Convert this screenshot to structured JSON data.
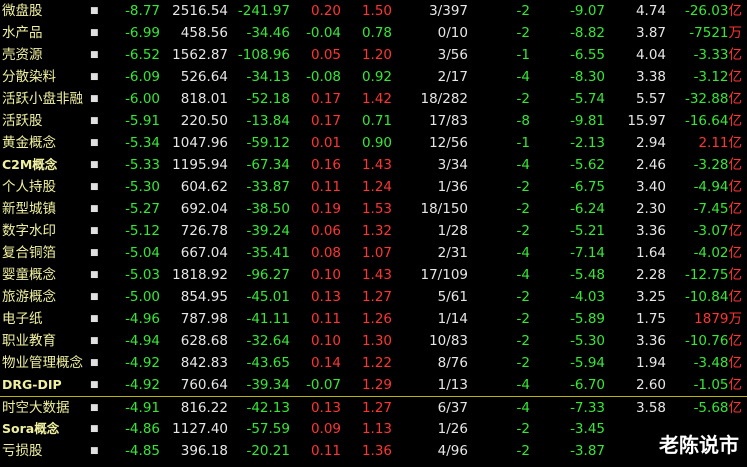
{
  "colors": {
    "background": "#000000",
    "down": "#35e835",
    "up": "#ff3434",
    "neutral": "#e6e6e6",
    "name": "#f0f0a0",
    "divider": "#b8b400"
  },
  "rows": [
    {
      "name": "微盘股",
      "flag": "■",
      "pct": "-8.77",
      "price": "2516.54",
      "chg": "-241.97",
      "spd": "0.20",
      "vol": "1.50",
      "rf": "3/397",
      "tc": "-2",
      "d5": "-9.07",
      "tor": "4.74",
      "flow": "-26.03",
      "unit": "亿"
    },
    {
      "name": "水产品",
      "flag": "■",
      "pct": "-6.99",
      "price": "458.56",
      "chg": "-34.46",
      "spd": "-0.04",
      "vol": "0.78",
      "rf": "0/10",
      "tc": "-2",
      "d5": "-8.82",
      "tor": "3.87",
      "flow": "-7521",
      "unit": "万"
    },
    {
      "name": "壳资源",
      "flag": "■",
      "pct": "-6.52",
      "price": "1562.87",
      "chg": "-108.96",
      "spd": "0.05",
      "vol": "1.20",
      "rf": "3/56",
      "tc": "-1",
      "d5": "-6.55",
      "tor": "4.04",
      "flow": "-3.33",
      "unit": "亿"
    },
    {
      "name": "分散染料",
      "flag": "■",
      "pct": "-6.09",
      "price": "526.64",
      "chg": "-34.13",
      "spd": "-0.08",
      "vol": "0.92",
      "rf": "2/17",
      "tc": "-4",
      "d5": "-8.30",
      "tor": "3.38",
      "flow": "-3.12",
      "unit": "亿"
    },
    {
      "name": "活跃小盘非融",
      "flag": "■",
      "pct": "-6.00",
      "price": "818.01",
      "chg": "-52.18",
      "spd": "0.17",
      "vol": "1.42",
      "rf": "18/282",
      "tc": "-2",
      "d5": "-5.74",
      "tor": "5.57",
      "flow": "-32.88",
      "unit": "亿"
    },
    {
      "name": "活跃股",
      "flag": "■",
      "pct": "-5.91",
      "price": "220.50",
      "chg": "-13.84",
      "spd": "0.17",
      "vol": "0.71",
      "rf": "17/83",
      "tc": "-8",
      "d5": "-9.81",
      "tor": "15.97",
      "flow": "-16.64",
      "unit": "亿"
    },
    {
      "name": "黄金概念",
      "flag": "■",
      "pct": "-5.34",
      "price": "1047.96",
      "chg": "-59.12",
      "spd": "0.01",
      "vol": "0.90",
      "rf": "12/56",
      "tc": "-1",
      "d5": "-2.13",
      "tor": "2.94",
      "flow": "2.11",
      "unit": "亿"
    },
    {
      "name": "C2M概念",
      "flag": "■",
      "pct": "-5.33",
      "price": "1195.94",
      "chg": "-67.34",
      "spd": "0.16",
      "vol": "1.43",
      "rf": "3/34",
      "tc": "-4",
      "d5": "-5.62",
      "tor": "2.46",
      "flow": "-3.28",
      "unit": "亿"
    },
    {
      "name": "个人持股",
      "flag": "■",
      "pct": "-5.30",
      "price": "604.62",
      "chg": "-33.87",
      "spd": "0.11",
      "vol": "1.24",
      "rf": "1/36",
      "tc": "-2",
      "d5": "-6.75",
      "tor": "3.40",
      "flow": "-4.94",
      "unit": "亿"
    },
    {
      "name": "新型城镇",
      "flag": "■",
      "pct": "-5.27",
      "price": "692.04",
      "chg": "-38.50",
      "spd": "0.19",
      "vol": "1.53",
      "rf": "18/150",
      "tc": "-2",
      "d5": "-6.24",
      "tor": "2.30",
      "flow": "-7.45",
      "unit": "亿"
    },
    {
      "name": "数字水印",
      "flag": "■",
      "pct": "-5.12",
      "price": "726.78",
      "chg": "-39.24",
      "spd": "0.06",
      "vol": "1.32",
      "rf": "1/28",
      "tc": "-2",
      "d5": "-5.21",
      "tor": "3.36",
      "flow": "-3.07",
      "unit": "亿"
    },
    {
      "name": "复合铜箔",
      "flag": "■",
      "pct": "-5.04",
      "price": "667.04",
      "chg": "-35.41",
      "spd": "0.08",
      "vol": "1.07",
      "rf": "2/31",
      "tc": "-4",
      "d5": "-7.14",
      "tor": "1.64",
      "flow": "-4.02",
      "unit": "亿"
    },
    {
      "name": "婴童概念",
      "flag": "■",
      "pct": "-5.03",
      "price": "1818.92",
      "chg": "-96.27",
      "spd": "0.10",
      "vol": "1.43",
      "rf": "17/109",
      "tc": "-4",
      "d5": "-5.48",
      "tor": "2.28",
      "flow": "-12.75",
      "unit": "亿"
    },
    {
      "name": "旅游概念",
      "flag": "■",
      "pct": "-5.00",
      "price": "854.95",
      "chg": "-45.01",
      "spd": "0.13",
      "vol": "1.27",
      "rf": "5/61",
      "tc": "-2",
      "d5": "-4.03",
      "tor": "3.25",
      "flow": "-10.84",
      "unit": "亿"
    },
    {
      "name": "电子纸",
      "flag": "■",
      "pct": "-4.96",
      "price": "787.98",
      "chg": "-41.11",
      "spd": "0.11",
      "vol": "1.26",
      "rf": "1/14",
      "tc": "-2",
      "d5": "-5.89",
      "tor": "1.75",
      "flow": "1879",
      "unit": "万"
    },
    {
      "name": "职业教育",
      "flag": "■",
      "pct": "-4.94",
      "price": "628.68",
      "chg": "-32.64",
      "spd": "0.10",
      "vol": "1.30",
      "rf": "10/83",
      "tc": "-2",
      "d5": "-5.30",
      "tor": "3.36",
      "flow": "-10.76",
      "unit": "亿"
    },
    {
      "name": "物业管理概念",
      "flag": "■",
      "pct": "-4.92",
      "price": "842.83",
      "chg": "-43.65",
      "spd": "0.14",
      "vol": "1.22",
      "rf": "8/76",
      "tc": "-2",
      "d5": "-5.94",
      "tor": "1.94",
      "flow": "-3.48",
      "unit": "亿"
    },
    {
      "name": "DRG-DIP",
      "flag": "■",
      "pct": "-4.92",
      "price": "760.64",
      "chg": "-39.34",
      "spd": "-0.07",
      "vol": "1.29",
      "rf": "1/13",
      "tc": "-4",
      "d5": "-6.70",
      "tor": "2.60",
      "flow": "-1.05",
      "unit": "亿"
    },
    {
      "name": "时空大数据",
      "flag": "■",
      "pct": "-4.91",
      "price": "816.22",
      "chg": "-42.13",
      "spd": "0.13",
      "vol": "1.27",
      "rf": "6/37",
      "tc": "-4",
      "d5": "-7.33",
      "tor": "3.58",
      "flow": "-5.68",
      "unit": "亿"
    },
    {
      "name": "Sora概念",
      "flag": "■",
      "pct": "-4.86",
      "price": "1127.40",
      "chg": "-57.59",
      "spd": "0.09",
      "vol": "1.13",
      "rf": "1/26",
      "tc": "-2",
      "d5": "-3.45",
      "tor": "",
      "flow": "",
      "unit": ""
    },
    {
      "name": "亏损股",
      "flag": "■",
      "pct": "-4.85",
      "price": "396.18",
      "chg": "-20.21",
      "spd": "0.11",
      "vol": "1.36",
      "rf": "4/96",
      "tc": "-2",
      "d5": "-3.87",
      "tor": "",
      "flow": "",
      "unit": ""
    }
  ],
  "watermark": "老陈说市"
}
